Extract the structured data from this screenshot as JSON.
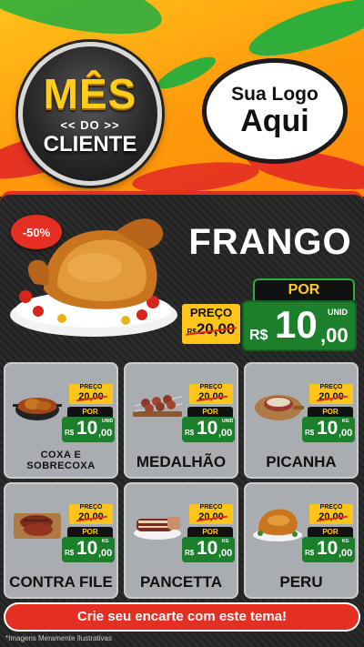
{
  "header": {
    "badge": {
      "line1": "MÊS",
      "line2": "<< DO >>",
      "line3": "CLIENTE"
    },
    "logo": {
      "line1": "Sua Logo",
      "line2": "Aqui"
    }
  },
  "hero": {
    "discount": "-50%",
    "name": "FRANGO",
    "old_label": "PREÇO",
    "old_currency": "R$",
    "old_price": "20,00",
    "new_label": "POR",
    "new_currency": "R$",
    "new_int": "10",
    "new_dec": ",00",
    "unit": "UNID"
  },
  "products": [
    {
      "name": "COXA E SOBRECOXA",
      "old_label": "PREÇO",
      "old_price": "20,00",
      "new_label": "POR",
      "currency": "R$",
      "int": "10",
      "dec": ",00",
      "unit": "UNID",
      "icon": "chicken-pot-icon"
    },
    {
      "name": "MEDALHÃO",
      "old_label": "PREÇO",
      "old_price": "20,00",
      "new_label": "POR",
      "currency": "R$",
      "int": "10",
      "dec": ",00",
      "unit": "UNID",
      "icon": "skewers-icon"
    },
    {
      "name": "PICANHA",
      "old_label": "PREÇO",
      "old_price": "20,00",
      "new_label": "POR",
      "currency": "R$",
      "int": "10",
      "dec": ",00",
      "unit": "KG",
      "icon": "picanha-board-icon"
    },
    {
      "name": "CONTRA FILE",
      "old_label": "PREÇO",
      "old_price": "20,00",
      "new_label": "POR",
      "currency": "R$",
      "int": "10",
      "dec": ",00",
      "unit": "KG",
      "icon": "steak-board-icon"
    },
    {
      "name": "PANCETTA",
      "old_label": "PREÇO",
      "old_price": "20,00",
      "new_label": "POR",
      "currency": "R$",
      "int": "10",
      "dec": ",00",
      "unit": "KG",
      "icon": "pancetta-icon"
    },
    {
      "name": "PERU",
      "old_label": "PREÇO",
      "old_price": "20,00",
      "new_label": "POR",
      "currency": "R$",
      "int": "10",
      "dec": ",00",
      "unit": "KG",
      "icon": "turkey-icon"
    }
  ],
  "footer": {
    "cta": "Crie seu encarte com este tema!",
    "disclaimer": "*Imagens Meramente Ilustrativas"
  },
  "colors": {
    "accent_red": "#e52f22",
    "price_green": "#1b7f2c",
    "price_yellow": "#ffc41a",
    "header_orange": "#ff9a0c"
  }
}
